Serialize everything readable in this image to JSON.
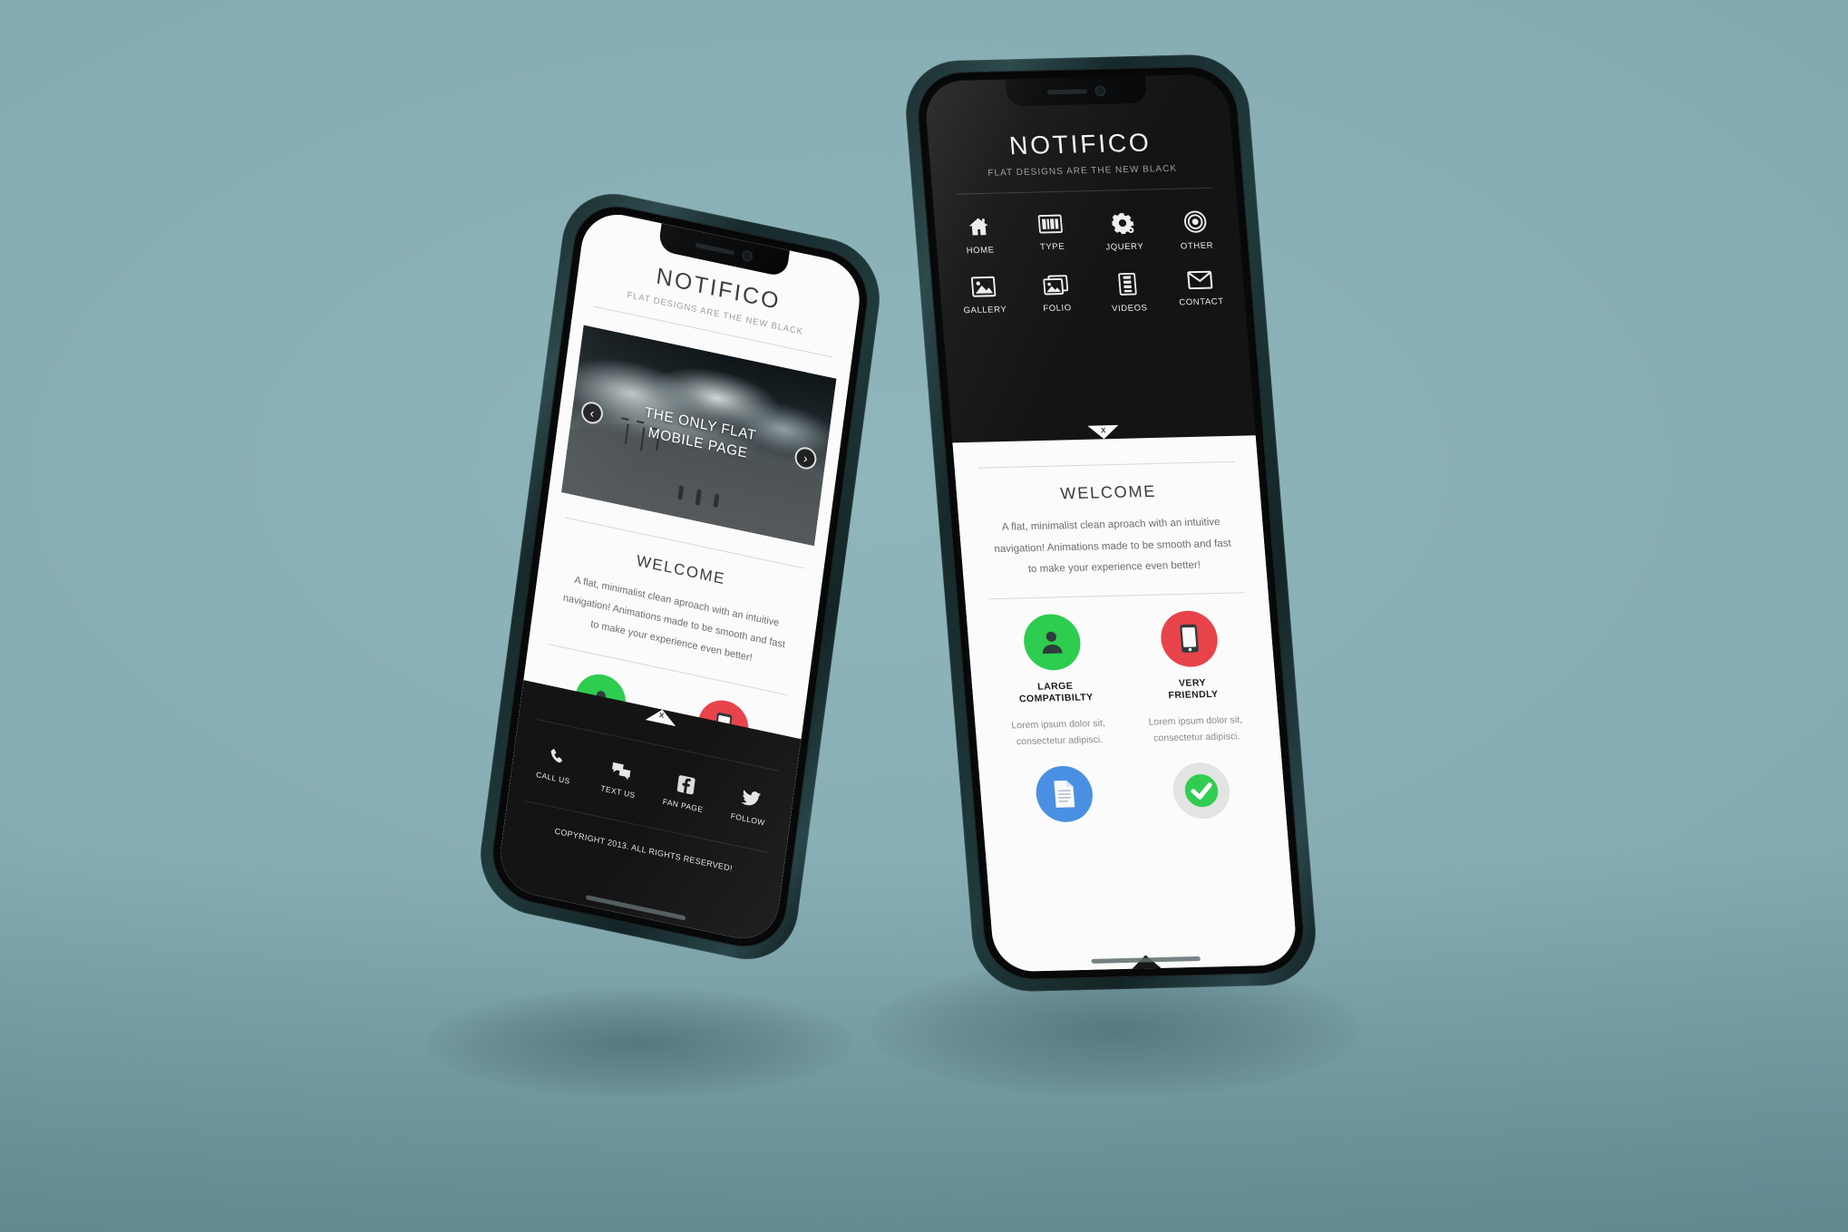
{
  "scene": {
    "background_color": "#81aab0",
    "phone_frame_color": "#203a3c",
    "device_count": 2
  },
  "site": {
    "brand": "NOTIFICO",
    "tagline": "FLAT DESIGNS ARE THE NEW BLACK"
  },
  "menu": {
    "items": [
      {
        "label": "HOME",
        "icon": "home-icon"
      },
      {
        "label": "TYPE",
        "icon": "typography-icon"
      },
      {
        "label": "JQUERY",
        "icon": "gear-icon"
      },
      {
        "label": "OTHER",
        "icon": "target-icon"
      },
      {
        "label": "GALLERY",
        "icon": "image-icon"
      },
      {
        "label": "FOLIO",
        "icon": "images-stack-icon"
      },
      {
        "label": "VIDEOS",
        "icon": "film-strip-icon"
      },
      {
        "label": "CONTACT",
        "icon": "envelope-icon"
      }
    ],
    "close_label": "X"
  },
  "slider": {
    "title_line1": "THE ONLY FLAT",
    "title_line2": "MOBILE PAGE",
    "prev_glyph": "‹",
    "next_glyph": "›"
  },
  "welcome": {
    "heading": "WELCOME",
    "paragraph_line1": "A flat, minimalist clean aproach with an intuitive",
    "paragraph_line2": "navigation! Animations made to be smooth and fast",
    "paragraph_line3": "to make your experience even better!"
  },
  "features": [
    {
      "title_line1": "LARGE",
      "title_line2": "COMPATIBILTY",
      "text_line1": "Lorem ipsum dolor sit,",
      "text_line2": "consectetur adipisci.",
      "icon": "person-icon",
      "color": "#2ecc4f"
    },
    {
      "title_line1": "VERY",
      "title_line2": "FRIENDLY",
      "text_line1": "Lorem ipsum dolor sit,",
      "text_line2": "consectetur adipisci.",
      "icon": "smartphone-icon",
      "color": "#e8434a"
    },
    {
      "title_line1": "",
      "title_line2": "",
      "text_line1": "",
      "text_line2": "",
      "icon": "document-icon",
      "color": "#4a90e2"
    },
    {
      "title_line1": "",
      "title_line2": "",
      "text_line1": "",
      "text_line2": "",
      "icon": "check-circle-icon",
      "color": "#e2e4e3"
    }
  ],
  "footer": {
    "items": [
      {
        "label": "CALL US",
        "icon": "phone-icon"
      },
      {
        "label": "TEXT US",
        "icon": "chat-bubbles-icon"
      },
      {
        "label": "FAN PAGE",
        "icon": "facebook-icon"
      },
      {
        "label": "FOLLOW",
        "icon": "twitter-bird-icon"
      }
    ],
    "copyright": "COPYRIGHT 2013. ALL RIGHTS RESERVED!",
    "toggle_label": "X"
  }
}
